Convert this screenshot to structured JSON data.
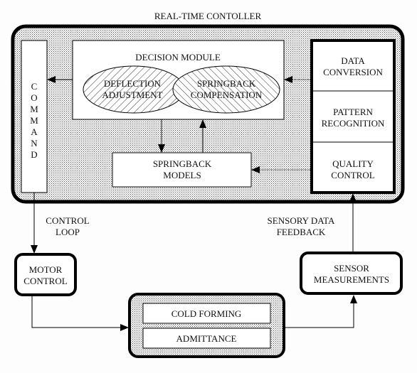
{
  "title": "REAL-TIME CONTOLLER",
  "controller": {
    "command": [
      "C",
      "O",
      "M",
      "M",
      "A",
      "N",
      "D"
    ],
    "decision_module": {
      "title": "DECISION MODULE",
      "deflection": [
        "DEFLECTION",
        "ADJUSTMENT"
      ],
      "springback": [
        "SPRINGBACK",
        "COMPENSATION"
      ]
    },
    "springback_models": [
      "SPRINGBACK",
      "MODELS"
    ],
    "sensor_stack": {
      "data_conversion": [
        "DATA",
        "CONVERSION"
      ],
      "pattern_recognition": [
        "PATTERN",
        "RECOGNITION"
      ],
      "quality_control": [
        "QUALITY",
        "CONTROL"
      ]
    }
  },
  "labels": {
    "control_loop": [
      "CONTROL",
      "LOOP"
    ],
    "sensory_feedback": [
      "SENSORY DATA",
      "FEEDBACK"
    ]
  },
  "motor_control": [
    "MOTOR",
    "CONTROL"
  ],
  "sensor_measurements": [
    "SENSOR",
    "MEASUREMENTS"
  ],
  "process": {
    "cold_forming": "COLD FORMING",
    "admittance": "ADMITTANCE"
  },
  "colors": {
    "line": "#000000",
    "box_fill": "#ffffff",
    "dot_fill": "#d8d8d8"
  }
}
